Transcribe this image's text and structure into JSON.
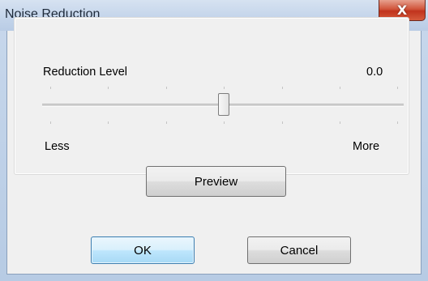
{
  "window": {
    "title": "Noise Reduction",
    "close_glyph": "X"
  },
  "group": {
    "label": "Reduction Level",
    "value": "0.0",
    "min_label": "Less",
    "max_label": "More"
  },
  "slider": {
    "position_fraction": 0.5,
    "tick_count": 7
  },
  "buttons": {
    "preview": "Preview",
    "ok": "OK",
    "cancel": "Cancel"
  },
  "colors": {
    "close_button": "#c0341d",
    "default_button_border": "#3c7fb1",
    "dialog_face": "#f0f0f0"
  }
}
